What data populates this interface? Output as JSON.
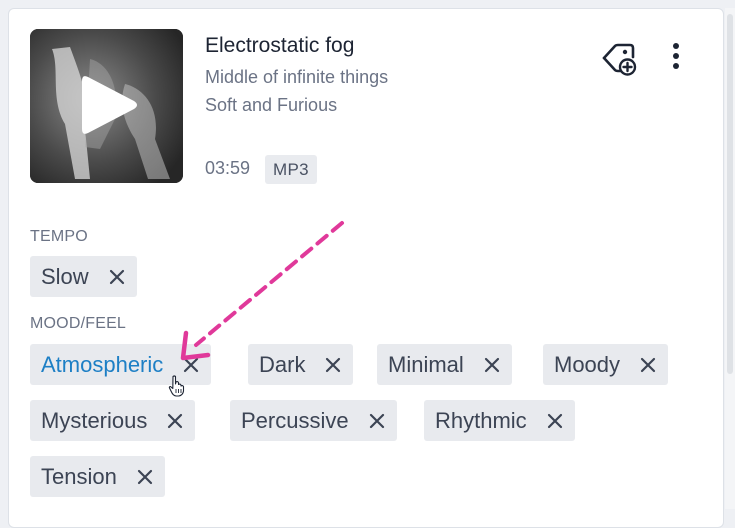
{
  "track": {
    "title": "Electrostatic fog",
    "album": "Middle of infinite things",
    "artist": "Soft and Furious",
    "duration": "03:59",
    "format": "MP3"
  },
  "icons": {
    "thumbnail_play": "play-icon",
    "add_tag": "tag-plus-icon",
    "more": "more-vertical-icon",
    "remove": "close-icon",
    "annotation": "pink-dashed-arrow",
    "pointer": "hand-cursor-icon"
  },
  "colors": {
    "accent": "#1d7fc5",
    "chip_bg": "#e8eaee",
    "annotation": "#e0399a"
  },
  "tempo": {
    "label": "TEMPO",
    "tags": [
      {
        "label": "Slow"
      }
    ]
  },
  "mood": {
    "label": "MOOD/FEEL",
    "tags": [
      {
        "label": "Atmospheric",
        "hovered": true
      },
      {
        "label": "Dark"
      },
      {
        "label": "Minimal"
      },
      {
        "label": "Moody"
      },
      {
        "label": "Mysterious"
      },
      {
        "label": "Percussive"
      },
      {
        "label": "Rhythmic"
      },
      {
        "label": "Tension"
      }
    ]
  }
}
